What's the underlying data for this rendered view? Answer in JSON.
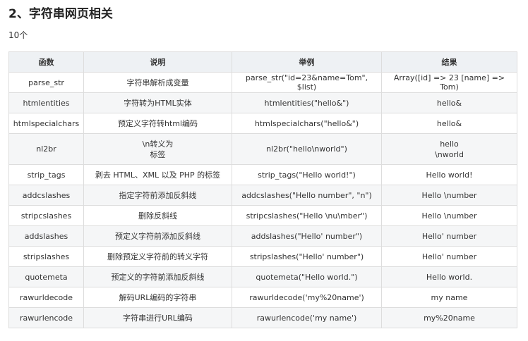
{
  "section": {
    "title": "2、字符串网页相关",
    "count": "10个"
  },
  "table": {
    "headers": [
      "函数",
      "说明",
      "举例",
      "结果"
    ],
    "rows": [
      [
        "parse_str",
        "字符串解析成变量",
        "parse_str(\"id=23&name=Tom\", $list)",
        "Array([id] => 23 [name] => Tom)"
      ],
      [
        "htmlentities",
        "字符转为HTML实体",
        "htmlentities(\"hello&\")",
        "hello&"
      ],
      [
        "htmlspecialchars",
        "预定义字符转html编码",
        "htmlspecialchars(\"hello&\")",
        "hello&"
      ],
      [
        "nl2br",
        "\\n转义为\n标签",
        "nl2br(\"hello\\nworld\")",
        "hello\n\\nworld"
      ],
      [
        "strip_tags",
        "剥去 HTML、XML 以及 PHP 的标签",
        "strip_tags(\"Hello world!\")",
        "Hello world!"
      ],
      [
        "addcslashes",
        "指定字符前添加反斜线",
        "addcslashes(\"Hello number\", \"n\")",
        "Hello \\number"
      ],
      [
        "stripcslashes",
        "删除反斜线",
        "stripcslashes(\"Hello \\nu\\mber\")",
        "Hello \\number"
      ],
      [
        "addslashes",
        "预定义字符前添加反斜线",
        "addslashes(\"Hello' number\")",
        "Hello' number"
      ],
      [
        "stripslashes",
        "删除预定义字符前的转义字符",
        "stripslashes(\"Hello' number\")",
        "Hello' number"
      ],
      [
        "quotemeta",
        "预定义的字符前添加反斜线",
        "quotemeta(\"Hello world.\")",
        "Hello world."
      ],
      [
        "rawurldecode",
        "解码URL编码的字符串",
        "rawurldecode('my%20name')",
        "my name"
      ],
      [
        "rawurlencode",
        "字符串进行URL编码",
        "rawurlencode('my name')",
        "my%20name"
      ]
    ]
  }
}
